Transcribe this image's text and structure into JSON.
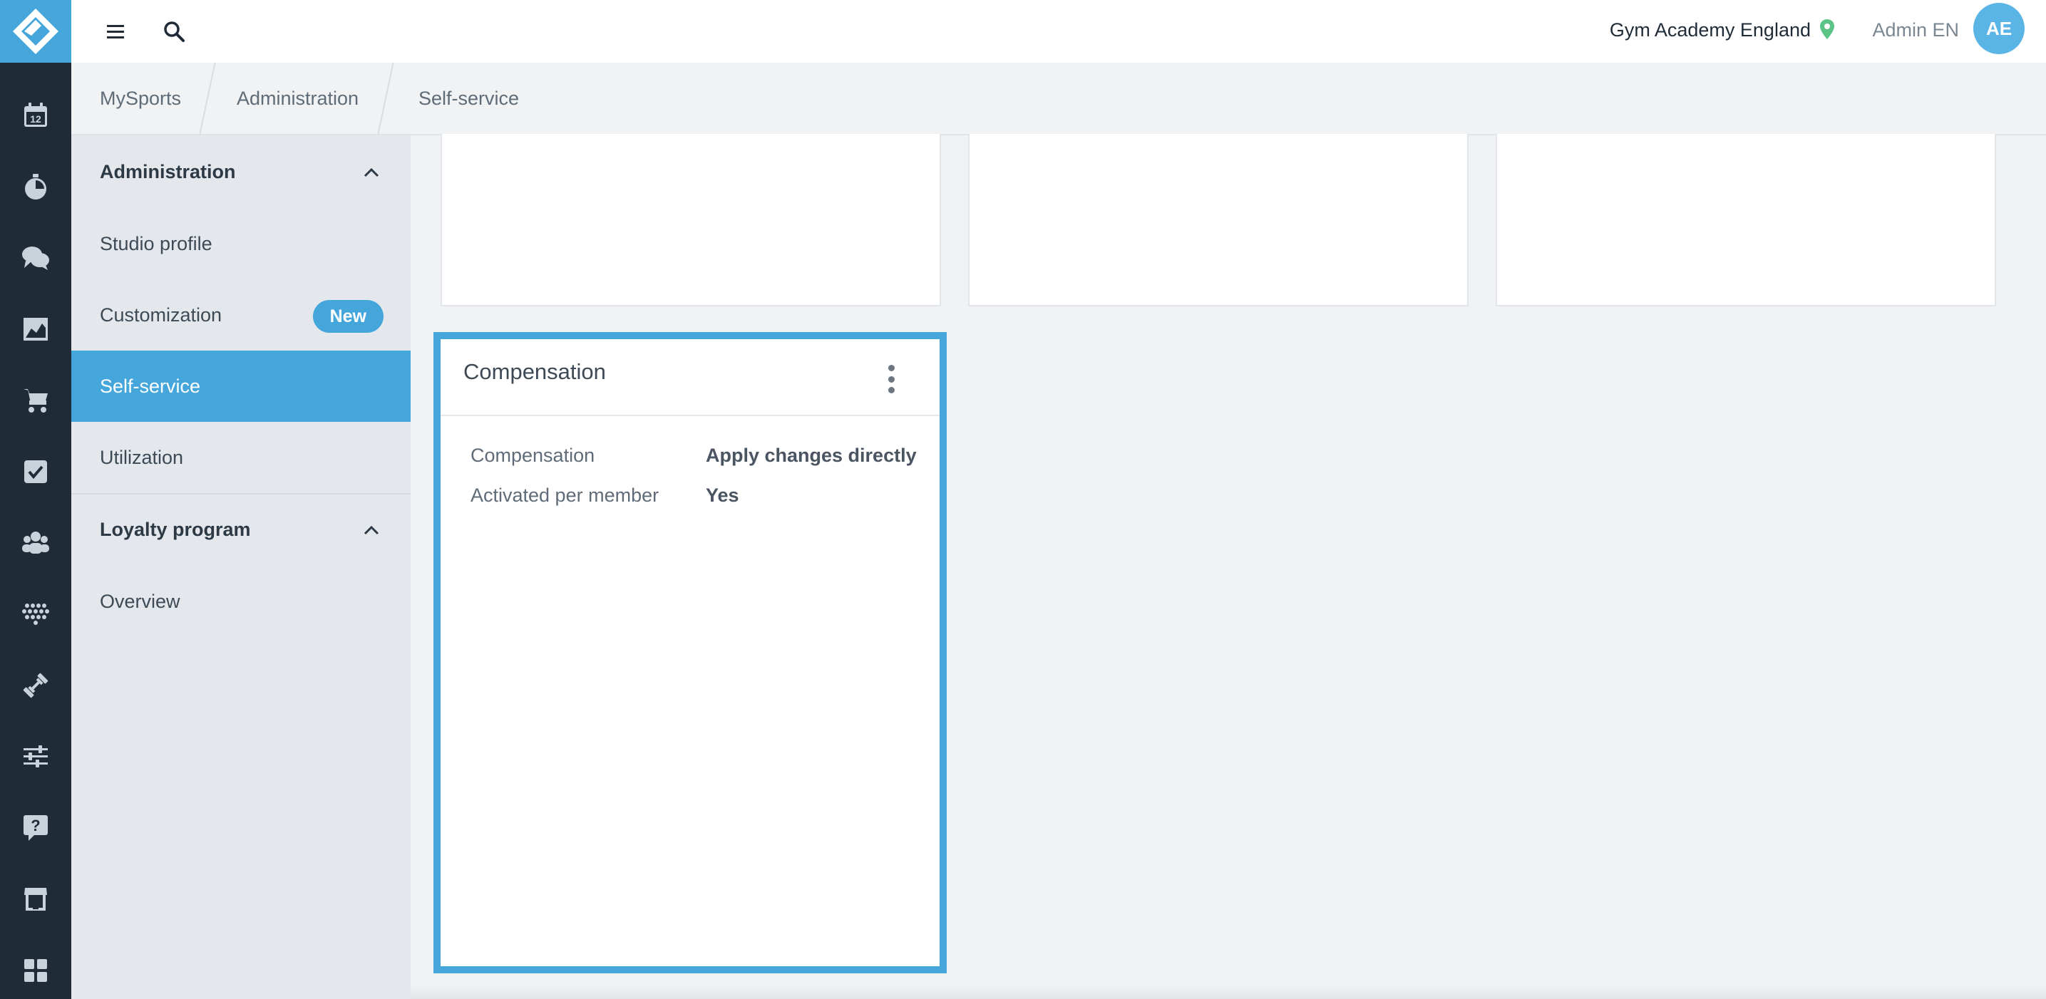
{
  "rail": {
    "icons": [
      "logo-icon",
      "calendar-icon",
      "stopwatch-icon",
      "chat-icon",
      "chart-icon",
      "cart-icon",
      "checkbox-icon",
      "members-icon",
      "heartbeat-icon",
      "dumbbell-icon",
      "sliders-icon",
      "help-icon",
      "store-icon",
      "dashboard-icon"
    ],
    "calendar_number": "12"
  },
  "topbar": {
    "studio": "Gym Academy England",
    "user": "Admin EN",
    "avatar_initials": "AE"
  },
  "breadcrumb": [
    "MySports",
    "Administration",
    "Self-service"
  ],
  "subnav": {
    "groups": [
      {
        "label": "Administration",
        "items": [
          {
            "label": "Studio profile"
          },
          {
            "label": "Customization",
            "badge": "New"
          },
          {
            "label": "Self-service",
            "active": true
          },
          {
            "label": "Utilization"
          }
        ]
      },
      {
        "label": "Loyalty program",
        "items": [
          {
            "label": "Overview"
          }
        ]
      }
    ]
  },
  "compensation_card": {
    "title": "Compensation",
    "rows": [
      {
        "label": "Compensation",
        "value": "Apply changes directly"
      },
      {
        "label": "Activated per member",
        "value": "Yes"
      }
    ]
  },
  "colors": {
    "accent": "#45a6db",
    "rail": "#1f2c38",
    "location_pin": "#5cc486"
  }
}
